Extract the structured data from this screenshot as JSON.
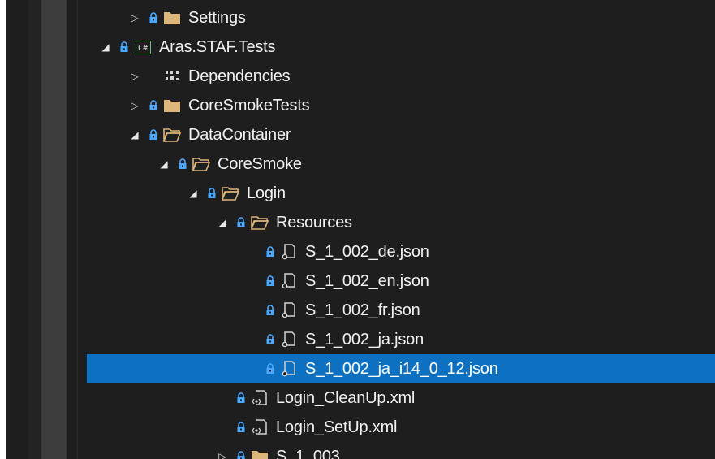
{
  "solution_explorer": {
    "rows": [
      {
        "depth": 0,
        "expander": "collapsed",
        "icon": "folder-closed-icon",
        "label": "Settings"
      },
      {
        "depth": -1,
        "expander": "expanded",
        "icon": "csharp-project-icon",
        "label": "Aras.STAF.Tests"
      },
      {
        "depth": 0,
        "expander": "collapsed",
        "icon": "dependencies-icon",
        "label": "Dependencies"
      },
      {
        "depth": 0,
        "expander": "collapsed",
        "icon": "folder-closed-icon",
        "label": "CoreSmokeTests"
      },
      {
        "depth": 0,
        "expander": "expanded",
        "icon": "folder-open-icon",
        "label": "DataContainer"
      },
      {
        "depth": 1,
        "expander": "expanded",
        "icon": "folder-open-icon",
        "label": "CoreSmoke"
      },
      {
        "depth": 2,
        "expander": "expanded",
        "icon": "folder-open-icon",
        "label": "Login"
      },
      {
        "depth": 3,
        "expander": "expanded",
        "icon": "folder-open-icon",
        "label": "Resources"
      },
      {
        "depth": 4,
        "expander": "none",
        "icon": "json-file-icon",
        "label": "S_1_002_de.json"
      },
      {
        "depth": 4,
        "expander": "none",
        "icon": "json-file-icon",
        "label": "S_1_002_en.json"
      },
      {
        "depth": 4,
        "expander": "none",
        "icon": "json-file-icon",
        "label": "S_1_002_fr.json"
      },
      {
        "depth": 4,
        "expander": "none",
        "icon": "json-file-icon",
        "label": "S_1_002_ja.json"
      },
      {
        "depth": 4,
        "expander": "none",
        "icon": "json-file-icon",
        "label": "S_1_002_ja_i14_0_12.json",
        "selected": true
      },
      {
        "depth": 3,
        "expander": "none",
        "icon": "xml-file-icon",
        "label": "Login_CleanUp.xml"
      },
      {
        "depth": 3,
        "expander": "none",
        "icon": "xml-file-icon",
        "label": "Login_SetUp.xml"
      },
      {
        "depth": 3,
        "expander": "collapsed",
        "icon": "folder-closed-icon",
        "label": "S_1_003"
      }
    ],
    "colors": {
      "background": "#1e1e1e",
      "selection": "#0e70c0",
      "text": "#f1f1f1",
      "folder": "#dcb67a",
      "lock": "#4aa8ff"
    }
  }
}
